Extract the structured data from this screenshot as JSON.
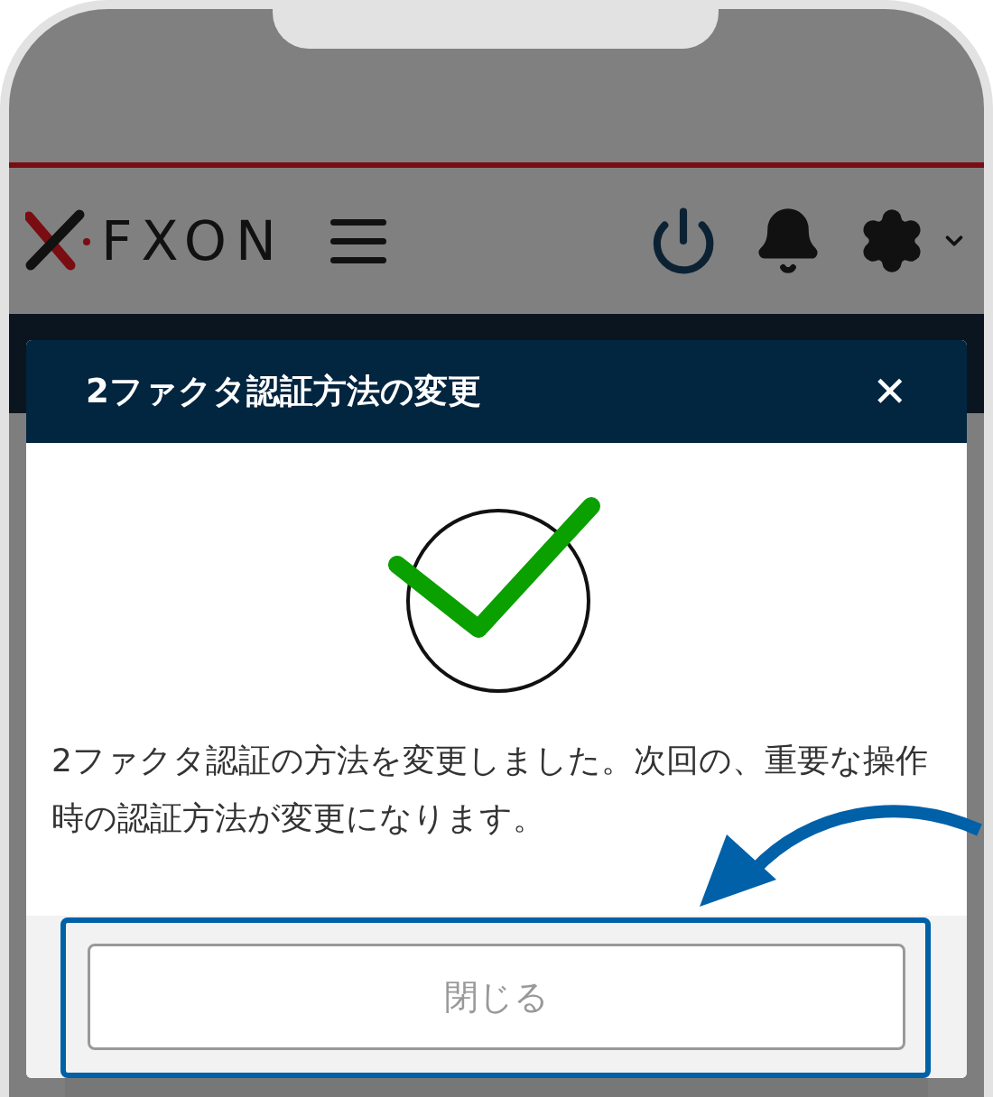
{
  "header": {
    "logo": "FXON"
  },
  "dialog": {
    "title": "2ファクタ認証方法の変更",
    "close": "✕",
    "message": "2ファクタ認証の方法を変更しました。次回の、重要な操作時の認証方法が変更になります。",
    "button": "閉じる"
  },
  "annotation": {
    "highlight": true
  }
}
